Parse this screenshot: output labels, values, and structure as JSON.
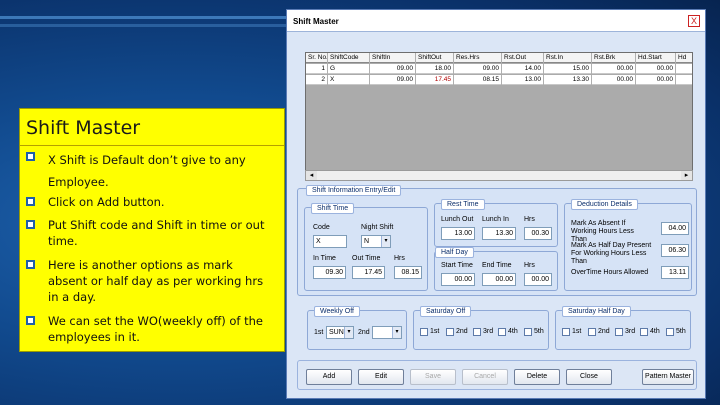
{
  "note": {
    "title": "Shift Master",
    "bullets": [
      "X Shift is Default don’t give to any Employee.",
      "Click on Add button.",
      "Put Shift code and Shift in time or out time.",
      "Here is another options as mark absent  or half day as per working hrs in a day.",
      "We can set the WO(weekly off) of the employees in it."
    ]
  },
  "window": {
    "title": "Shift Master",
    "close": "X"
  },
  "grid": {
    "columns": [
      "Sr. No.",
      "ShiftCode",
      "ShiftIn",
      "ShiftOut",
      "Res.Hrs",
      "Rst.Out",
      "Rst.In",
      "Rst.Brk",
      "Hd.Start",
      "Hd"
    ],
    "rows": [
      [
        "1",
        "G",
        "09.00",
        "18.00",
        "09.00",
        "14.00",
        "15.00",
        "00.00",
        "00.00",
        ""
      ],
      [
        "2",
        "X",
        "09.00",
        "17.45",
        "08.15",
        "13.00",
        "13.30",
        "00.00",
        "00.00",
        ""
      ]
    ]
  },
  "shift_info": {
    "tab": "Shift Information Entry/Edit",
    "shift_time": {
      "label": "Shift Time",
      "code_label": "Code",
      "night_label": "Night Shift",
      "code_value": "X",
      "night_value": "N",
      "in_label": "In Time",
      "out_label": "Out Time",
      "hrs_label": "Hrs",
      "in_value": "09.30",
      "out_value": "17.45",
      "hrs_value": "08.15"
    },
    "rest_time": {
      "label": "Rest Time",
      "lunch_out_label": "Lunch Out",
      "lunch_in_label": "Lunch In",
      "hrs_label": "Hrs",
      "lunch_out_value": "13.00",
      "lunch_in_value": "13.30",
      "hrs_value": "00.30"
    },
    "half_day": {
      "label": "Half Day",
      "start_label": "Start Time",
      "end_label": "End Time",
      "hrs_label": "Hrs",
      "start_value": "00.00",
      "end_value": "00.00",
      "hrs_value": "00.00"
    },
    "deduction": {
      "label": "Deduction Details",
      "absent_label": "Mark As Absent If Working Hours Less Than",
      "absent_value": "04.00",
      "halfday_label": "Mark As Half Day Present For Working Hours Less Than",
      "halfday_value": "06.30",
      "overtime_label": "OverTime Hours Allowed",
      "overtime_value": "13.11"
    }
  },
  "weekly_off": {
    "label": "Weekly Off",
    "first_label": "1st",
    "first_value": "SUN",
    "second_label": "2nd"
  },
  "saturday_off": {
    "label": "Saturday Off",
    "options": [
      "1st",
      "2nd",
      "3rd",
      "4th",
      "5th"
    ]
  },
  "saturday_half": {
    "label": "Saturday Half Day",
    "options": [
      "1st",
      "2nd",
      "3rd",
      "4th",
      "5th"
    ]
  },
  "buttons": {
    "add": "Add",
    "edit": "Edit",
    "save": "Save",
    "cancel": "Cancel",
    "delete": "Delete",
    "close": "Close",
    "pattern": "Pattern Master"
  }
}
